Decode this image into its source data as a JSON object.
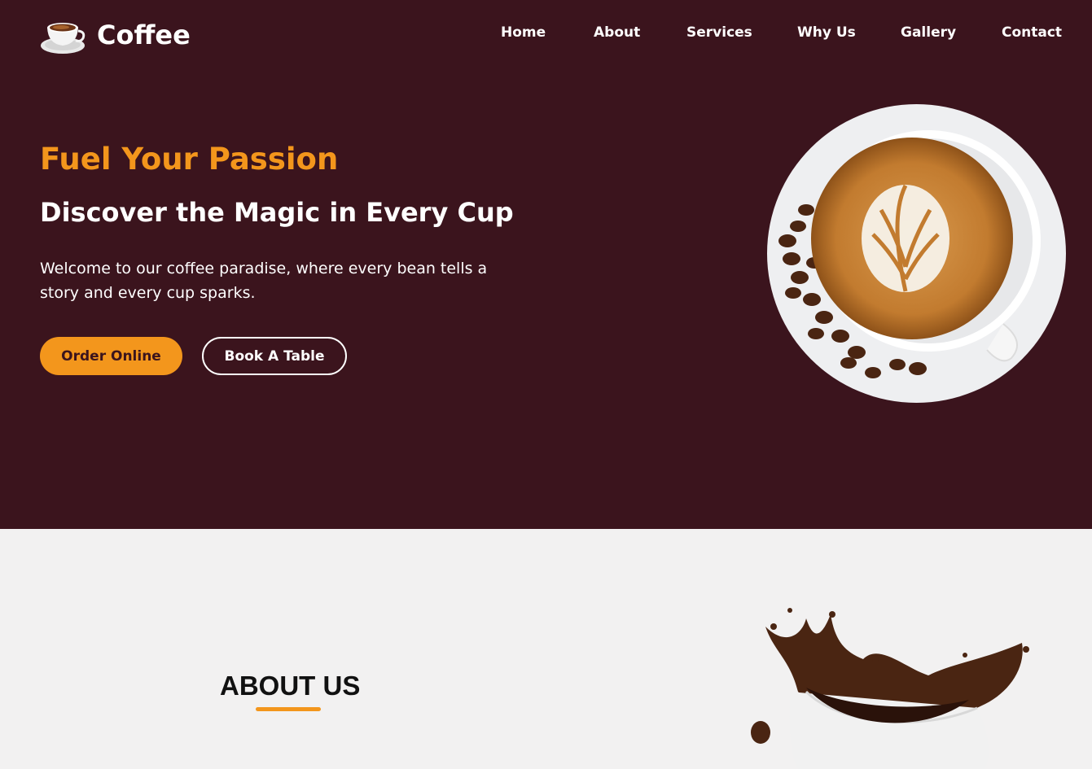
{
  "brand": {
    "name": "Coffee",
    "logo_icon": "coffee-cup-logo-icon"
  },
  "nav": {
    "items": [
      {
        "label": "Home"
      },
      {
        "label": "About"
      },
      {
        "label": "Services"
      },
      {
        "label": "Why Us"
      },
      {
        "label": "Gallery"
      },
      {
        "label": "Contact"
      }
    ]
  },
  "hero": {
    "tagline": "Fuel Your Passion",
    "title": "Discover the Magic in Every Cup",
    "description": "Welcome to our coffee paradise, where every bean tells a story and every cup sparks.",
    "buttons": {
      "order_label": "Order Online",
      "book_label": "Book A Table"
    },
    "image_icon": "latte-art-cup-image"
  },
  "about": {
    "title": "ABOUT US",
    "image_icon": "coffee-splash-image"
  },
  "colors": {
    "hero_background": "#3b141d",
    "accent": "#f3961c",
    "page_background": "#f2f1f1"
  }
}
